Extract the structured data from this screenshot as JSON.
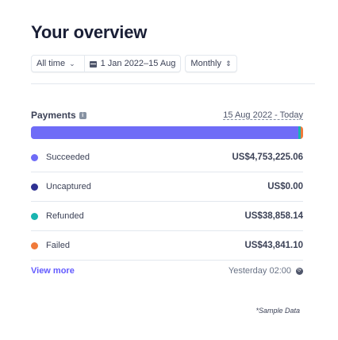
{
  "header": {
    "title": "Your overview"
  },
  "filters": {
    "range_preset": "All time",
    "date_range": "1 Jan 2022–15 Aug",
    "interval": "Monthly"
  },
  "payments": {
    "label": "Payments",
    "range_link": "15 Aug 2022 - Today",
    "bar": [
      {
        "name": "Succeeded",
        "fraction": 0.9839,
        "color": "#6f6cf7"
      },
      {
        "name": "Uncaptured",
        "fraction": 0.0,
        "color": "#2e3192"
      },
      {
        "name": "Refunded",
        "fraction": 0.008,
        "color": "#19b5b0"
      },
      {
        "name": "Failed",
        "fraction": 0.009,
        "color": "#f07a3a"
      }
    ],
    "rows": [
      {
        "label": "Succeeded",
        "amount": "US$4,753,225.06",
        "color": "#6f6cf7"
      },
      {
        "label": "Uncaptured",
        "amount": "US$0.00",
        "color": "#2e3192"
      },
      {
        "label": "Refunded",
        "amount": "US$38,858.14",
        "color": "#19b5b0"
      },
      {
        "label": "Failed",
        "amount": "US$43,841.10",
        "color": "#f07a3a"
      }
    ]
  },
  "footer": {
    "view_more": "View more",
    "updated": "Yesterday 02:00"
  },
  "note": "*Sample Data"
}
